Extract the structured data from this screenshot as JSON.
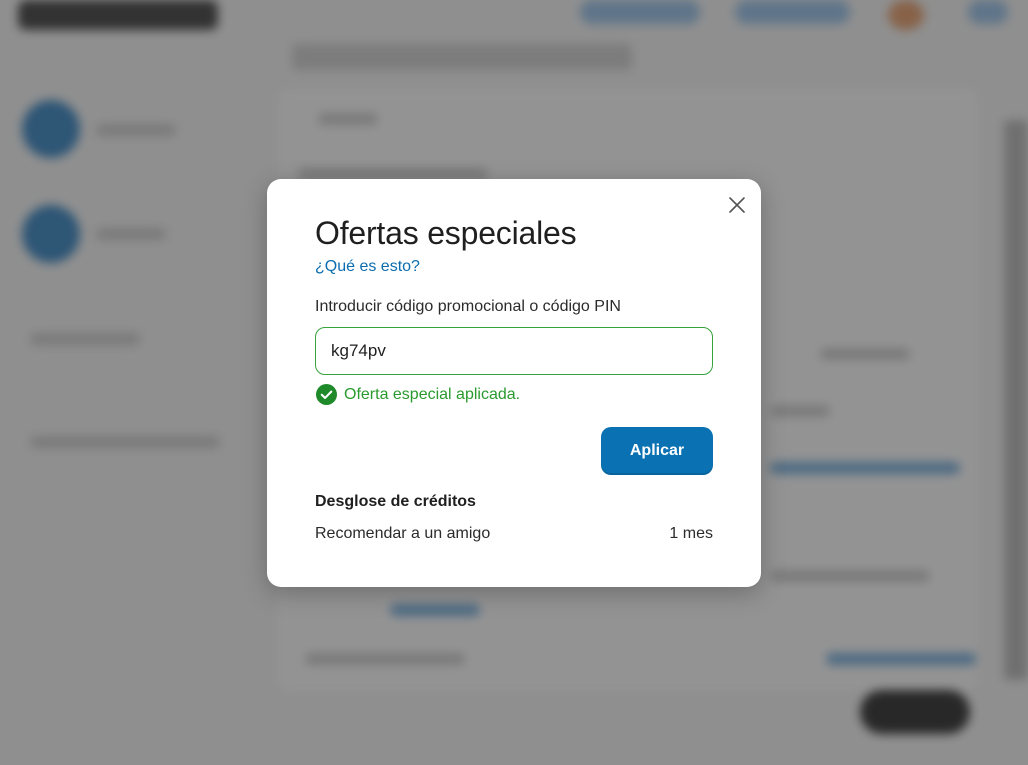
{
  "modal": {
    "title": "Ofertas especiales",
    "help_link": "¿Qué es esto?",
    "field_label": "Introducir código promocional o código PIN",
    "promo_input": {
      "value": "kg74pv",
      "placeholder": ""
    },
    "success_message": "Oferta especial aplicada.",
    "apply_label": "Aplicar",
    "breakdown": {
      "title": "Desglose de créditos",
      "items": [
        {
          "label": "Recomendar a un amigo",
          "value": "1 mes"
        }
      ]
    },
    "close_icon": "close-icon",
    "success_icon": "check-circle-icon"
  },
  "colors": {
    "accent": "#0a72b3",
    "success": "#2a9a2f",
    "overlay": "rgba(0,0,0,0.40)"
  }
}
